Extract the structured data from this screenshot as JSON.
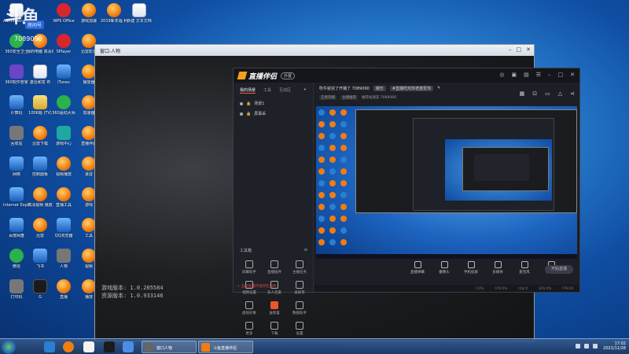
{
  "overlay": {
    "logo": "斗鱼",
    "room_label": "房间号",
    "room_number": "7089090"
  },
  "desktop_icons": [
    {
      "label": "Administrator",
      "col": 0,
      "row": 0,
      "style": "doc"
    },
    {
      "label": "WPS Office",
      "col": 2,
      "row": 0,
      "style": "red"
    },
    {
      "label": "游戏加速",
      "col": 3,
      "row": 0,
      "style": "orange"
    },
    {
      "label": "2019新年福 利美图",
      "col": 4,
      "row": 0,
      "style": "orange"
    },
    {
      "label": "新建 文本文档",
      "col": 5,
      "row": 0,
      "style": "doc"
    },
    {
      "label": "360安全卫士",
      "col": 0,
      "row": 1,
      "style": "green"
    },
    {
      "label": "我的电脑 高清视频",
      "col": 1,
      "row": 1,
      "style": "orange"
    },
    {
      "label": "SPlayer",
      "col": 2,
      "row": 1,
      "style": "red"
    },
    {
      "label": "迅雷影音",
      "col": 3,
      "row": 1,
      "style": "orange"
    },
    {
      "label": "360软件管家",
      "col": 0,
      "row": 2,
      "style": "purple"
    },
    {
      "label": "激活和发 布",
      "col": 1,
      "row": 2,
      "style": "doc"
    },
    {
      "label": "iTunes",
      "col": 2,
      "row": 2,
      "style": "blue"
    },
    {
      "label": "播放器",
      "col": 3,
      "row": 2,
      "style": "orange"
    },
    {
      "label": "计算机",
      "col": 0,
      "row": 3,
      "style": "blue"
    },
    {
      "label": "1006题 (TV)",
      "col": 1,
      "row": 3,
      "style": "folder"
    },
    {
      "label": "360驱动大师",
      "col": 2,
      "row": 3,
      "style": "green"
    },
    {
      "label": "加速器",
      "col": 3,
      "row": 3,
      "style": "orange"
    },
    {
      "label": "回收站",
      "col": 0,
      "row": 4,
      "style": "gray"
    },
    {
      "label": "迅雷下载",
      "col": 1,
      "row": 4,
      "style": "orange"
    },
    {
      "label": "游戏中心",
      "col": 2,
      "row": 4,
      "style": "teal"
    },
    {
      "label": "直播伴侣",
      "col": 3,
      "row": 4,
      "style": "orange"
    },
    {
      "label": "网络",
      "col": 0,
      "row": 5,
      "style": "blue"
    },
    {
      "label": "控制面板",
      "col": 1,
      "row": 5,
      "style": "blue"
    },
    {
      "label": "视频播放",
      "col": 2,
      "row": 5,
      "style": "orange"
    },
    {
      "label": "录屏",
      "col": 3,
      "row": 5,
      "style": "orange"
    },
    {
      "label": "Internet Explorer",
      "col": 0,
      "row": 6,
      "style": "blue"
    },
    {
      "label": "高清视频 播放",
      "col": 1,
      "row": 6,
      "style": "orange"
    },
    {
      "label": "直播工具",
      "col": 2,
      "row": 6,
      "style": "orange"
    },
    {
      "label": "游戏",
      "col": 3,
      "row": 6,
      "style": "orange"
    },
    {
      "label": "百度网盘",
      "col": 0,
      "row": 7,
      "style": "blue"
    },
    {
      "label": "迅雷",
      "col": 1,
      "row": 7,
      "style": "orange"
    },
    {
      "label": "QQ浏览器",
      "col": 2,
      "row": 7,
      "style": "blue"
    },
    {
      "label": "工具",
      "col": 3,
      "row": 7,
      "style": "orange"
    },
    {
      "label": "微信",
      "col": 0,
      "row": 8,
      "style": "green"
    },
    {
      "label": "飞书",
      "col": 1,
      "row": 8,
      "style": "blue"
    },
    {
      "label": "人物",
      "col": 2,
      "row": 8,
      "style": "gray"
    },
    {
      "label": "视频",
      "col": 3,
      "row": 8,
      "style": "orange"
    },
    {
      "label": "打印机",
      "col": 0,
      "row": 9,
      "style": "gray"
    },
    {
      "label": "G",
      "col": 1,
      "row": 9,
      "style": "black"
    },
    {
      "label": "直播",
      "col": 2,
      "row": 9,
      "style": "orange"
    },
    {
      "label": "播放",
      "col": 3,
      "row": 9,
      "style": "orange"
    },
    {
      "label": "文档",
      "col": 4,
      "row": 9,
      "style": "doc"
    }
  ],
  "preview_window": {
    "title": "窗口-人物",
    "version_label": "游戏版本: 1.0.205584",
    "resource_label": "资源版本: 1.0.933146"
  },
  "app": {
    "name": "直播伴侣",
    "version_badge": "外置",
    "tabs": [
      "我的场景",
      "工具",
      "互动区"
    ],
    "scenes": [
      "场景1",
      "屏幕采"
    ],
    "tools_header": "工具箱",
    "tools": [
      {
        "label": "屏幕助手",
        "hot": false
      },
      {
        "label": "直播插件",
        "hot": false
      },
      {
        "label": "主播任务",
        "hot": false
      },
      {
        "label": "视频设置",
        "hot": false
      },
      {
        "label": "多人连麦",
        "hot": false
      },
      {
        "label": "录屏等",
        "hot": false
      },
      {
        "label": "虚拟形象",
        "hot": false
      },
      {
        "label": "送惊喜",
        "hot": true
      },
      {
        "label": "数据助手",
        "hot": false
      },
      {
        "label": "更多",
        "hot": false
      },
      {
        "label": "下载",
        "hot": false
      },
      {
        "label": "设置",
        "hot": false
      }
    ],
    "warning": "⚠ 当前直播环境存在风险",
    "stream_title": "吹牛就完了开播了 7089090",
    "title_pills": [
      "娱乐",
      "#直播吃鸡你老婆爱你"
    ],
    "info_pills": [
      "王者荣耀",
      "主播推荐",
      "推荐给朋友 7089090"
    ],
    "bottom_buttons": [
      "直播弹幕",
      "摄像头",
      "手机投屏",
      "多媒体",
      "麦克风",
      "扬声器"
    ],
    "start_live": "开始直播",
    "status_items": [
      "0.0%",
      "CPU:0%",
      "内存:0",
      "GPU:0%",
      "FPS:00"
    ]
  },
  "taskbar": {
    "tasks": [
      "窗口人物",
      "斗鱼直播伴侣"
    ],
    "time": "17:02",
    "date": "2021/11/28"
  }
}
